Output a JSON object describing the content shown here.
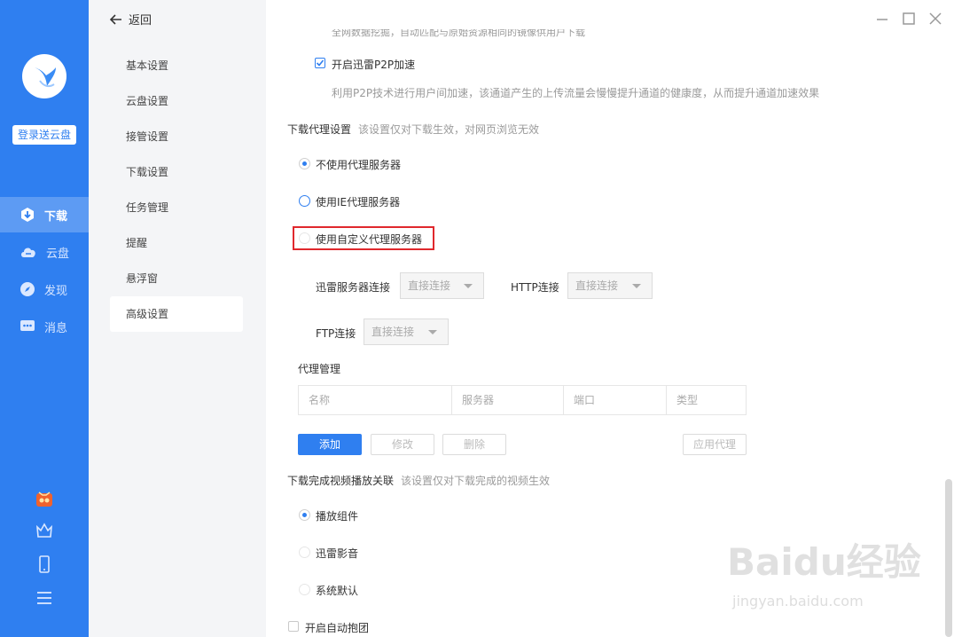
{
  "sidebar": {
    "login_label": "登录送云盘",
    "items": [
      {
        "label": "下载",
        "icon": "download-icon"
      },
      {
        "label": "云盘",
        "icon": "cloud-icon"
      },
      {
        "label": "发现",
        "icon": "compass-icon"
      },
      {
        "label": "消息",
        "icon": "message-icon"
      }
    ],
    "accent": "#2f7ff0"
  },
  "header": {
    "back_label": "返回"
  },
  "subnav": {
    "items": [
      "基本设置",
      "云盘设置",
      "接管设置",
      "下载设置",
      "任务管理",
      "提醒",
      "悬浮窗",
      "高级设置"
    ],
    "active": "高级设置"
  },
  "main": {
    "cut_text": "全网数据挖掘，自动匹配与原始资源相同的镜像供用户下载",
    "p2p_checkbox": "开启迅雷P2P加速",
    "p2p_desc": "利用P2P技术进行用户间加速，该通道产生的上传流量会慢慢提升通道的健康度，从而提升通道加速效果",
    "proxy_section": {
      "title": "下载代理设置",
      "hint": "该设置仅对下载生效，对网页浏览无效"
    },
    "proxy_options": [
      "不使用代理服务器",
      "使用IE代理服务器",
      "使用自定义代理服务器"
    ],
    "xunlei_conn_label": "迅雷服务器连接",
    "http_conn_label": "HTTP连接",
    "ftp_conn_label": "FTP连接",
    "conn_value": "直接连接",
    "proxy_mgmt_title": "代理管理",
    "table_headers": [
      "名称",
      "服务器",
      "端口",
      "类型"
    ],
    "buttons": {
      "add": "添加",
      "edit": "修改",
      "delete": "删除",
      "apply": "应用代理"
    },
    "video_section": {
      "title": "下载完成视频播放关联",
      "hint": "该设置仅对下载完成的视频生效"
    },
    "video_options": [
      "播放组件",
      "迅雷影音",
      "系统默认"
    ],
    "auto_group": "开启自动抱团"
  },
  "watermark": {
    "main": "Baidu经验",
    "sub": "jingyan.baidu.com"
  }
}
